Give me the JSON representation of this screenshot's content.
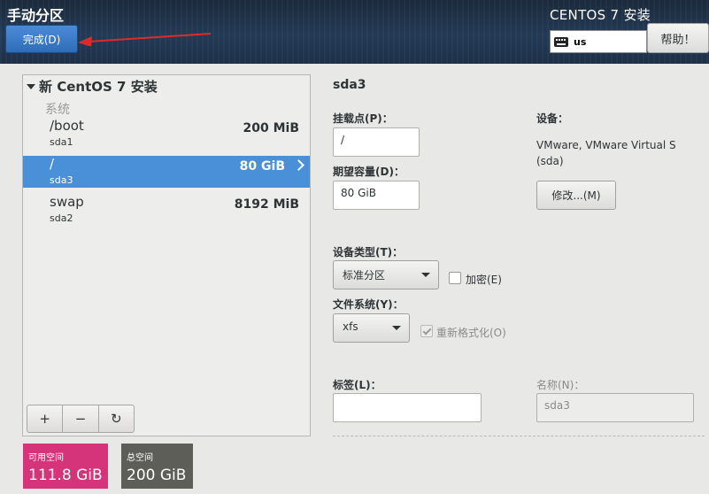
{
  "header": {
    "title": "手动分区",
    "done_label": "完成(D)",
    "install_title": "CENTOS 7 安装",
    "keyboard_layout": "us",
    "help_label": "帮助！"
  },
  "tree": {
    "heading": "新 CentOS 7 安装",
    "group_label": "系统",
    "partitions": [
      {
        "mount": "/boot",
        "device": "sda1",
        "size": "200 MiB",
        "selected": false
      },
      {
        "mount": "/",
        "device": "sda3",
        "size": "80 GiB",
        "selected": true
      },
      {
        "mount": "swap",
        "device": "sda2",
        "size": "8192 MiB",
        "selected": false
      }
    ]
  },
  "toolbar": {
    "add": "+",
    "remove": "−",
    "refresh": "↻"
  },
  "space": {
    "available_label": "可用空间",
    "available_value": "111.8 GiB",
    "total_label": "总空间",
    "total_value": "200 GiB"
  },
  "detail": {
    "title": "sda3",
    "mount_label": "挂载点(P)：",
    "mount_value": "/",
    "capacity_label": "期望容量(D)：",
    "capacity_value": "80 GiB",
    "device_label": "设备：",
    "device_info_line1": "VMware, VMware Virtual S",
    "device_info_line2": "(sda)",
    "modify_label": "修改...(M)",
    "device_type_label": "设备类型(T)：",
    "device_type_value": "标准分区",
    "encrypt_label": "加密(E)",
    "filesystem_label": "文件系统(Y)：",
    "filesystem_value": "xfs",
    "reformat_label": "重新格式化(O)",
    "tag_label": "标签(L)：",
    "tag_value": "",
    "name_label": "名称(N)：",
    "name_value": "sda3"
  },
  "colors": {
    "accent": "#4a90d9",
    "available": "#d6347a",
    "total": "#5e5e58",
    "arrow": "#e02a2a"
  }
}
